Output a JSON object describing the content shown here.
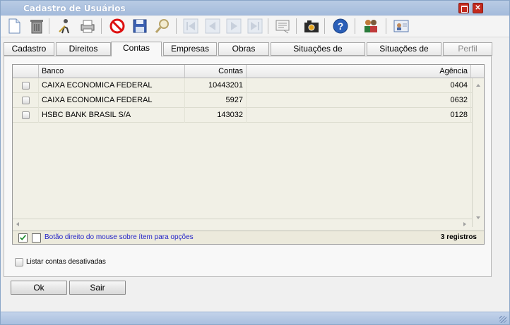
{
  "window": {
    "title": "Cadastro de Usuários"
  },
  "toolbar": {
    "icons": [
      "new-document-icon",
      "trash-icon",
      "edit-user-icon",
      "printer-icon",
      "cancel-icon",
      "save-icon",
      "search-icon",
      "first-record-icon",
      "previous-record-icon",
      "next-record-icon",
      "last-record-icon",
      "notes-icon",
      "camera-icon",
      "help-icon",
      "users-group-icon",
      "user-card-icon"
    ]
  },
  "tabs": [
    {
      "label": "Cadastro"
    },
    {
      "label": "Direitos"
    },
    {
      "label": "Contas"
    },
    {
      "label": "Empresas"
    },
    {
      "label": "Obras"
    },
    {
      "label": "Situações de atendimento"
    },
    {
      "label": "Situações de venda"
    },
    {
      "label": "Perfil"
    }
  ],
  "grid": {
    "columns": {
      "banco": "Banco",
      "contas": "Contas",
      "agencia": "Agência"
    },
    "rows": [
      {
        "banco": "CAIXA ECONOMICA FEDERAL",
        "contas": "10443201",
        "agencia": "0404"
      },
      {
        "banco": "CAIXA ECONOMICA FEDERAL",
        "contas": "5927",
        "agencia": "0632"
      },
      {
        "banco": "HSBC BANK BRASIL S/A",
        "contas": "143032",
        "agencia": "0128"
      }
    ],
    "footer_hint": "Botão direito do mouse sobre ítem para opções",
    "footer_count": "3 registros"
  },
  "options": {
    "show_inactive_label": "Listar contas desativadas"
  },
  "buttons": {
    "ok": "Ok",
    "exit": "Sair"
  },
  "colors": {
    "title_bar": "#a5bcdc",
    "grid_background": "#f1f0e6",
    "hint_text": "#2424c8",
    "close_button": "#c22a1e"
  }
}
